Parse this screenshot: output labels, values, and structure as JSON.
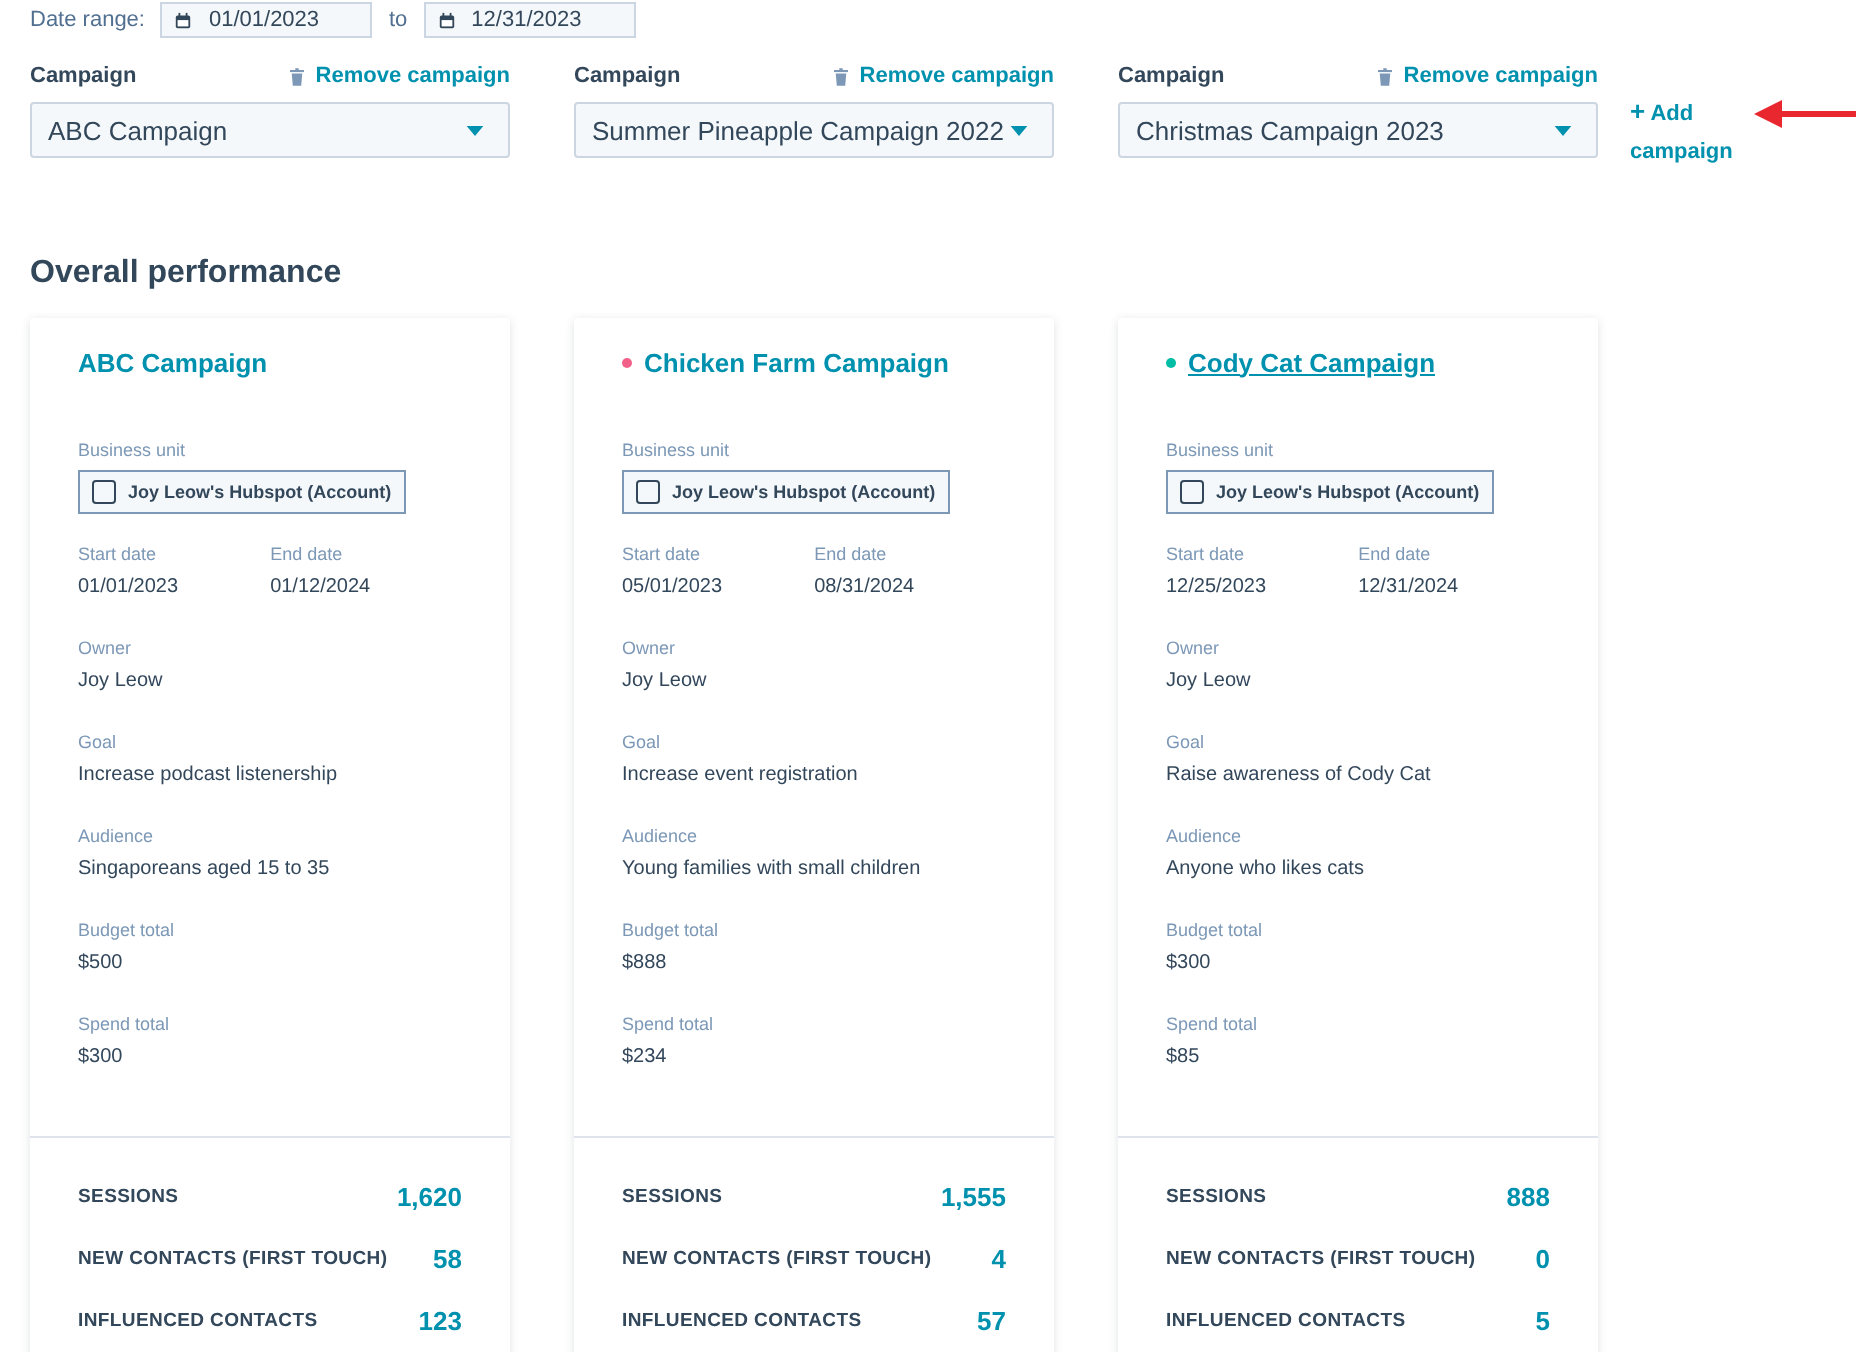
{
  "date_range": {
    "label": "Date range:",
    "start": "01/01/2023",
    "separator": "to",
    "end": "12/31/2023"
  },
  "selectors": [
    {
      "label": "Campaign",
      "remove": "Remove campaign",
      "value": "ABC Campaign"
    },
    {
      "label": "Campaign",
      "remove": "Remove campaign",
      "value": "Summer Pineapple Campaign 2022"
    },
    {
      "label": "Campaign",
      "remove": "Remove campaign",
      "value": "Christmas Campaign 2023"
    }
  ],
  "add_campaign": {
    "icon": "+",
    "label": "Add campaign"
  },
  "section_title": "Overall performance",
  "cards": [
    {
      "title": "ABC Campaign",
      "underlined": false,
      "business_unit_label": "Business unit",
      "business_unit": "Joy Leow's Hubspot (Account)",
      "fields": [
        {
          "label": "Start date",
          "value": "01/01/2023"
        },
        {
          "label": "End date",
          "value": "01/12/2024"
        },
        {
          "label": "Owner",
          "value": "Joy Leow"
        },
        {
          "label": "Goal",
          "value": "Increase podcast listenership"
        },
        {
          "label": "Audience",
          "value": "Singaporeans aged 15 to 35"
        },
        {
          "label": "Budget total",
          "value": "$500"
        },
        {
          "label": "Spend total",
          "value": "$300"
        }
      ],
      "metrics": [
        {
          "label": "SESSIONS",
          "value": "1,620"
        },
        {
          "label": "NEW CONTACTS (FIRST TOUCH)",
          "value": "58"
        },
        {
          "label": "INFLUENCED CONTACTS",
          "value": "123"
        }
      ]
    },
    {
      "title": "Chicken Farm Campaign",
      "color": "#f2618a",
      "underlined": false,
      "business_unit_label": "Business unit",
      "business_unit": "Joy Leow's Hubspot (Account)",
      "fields": [
        {
          "label": "Start date",
          "value": "05/01/2023"
        },
        {
          "label": "End date",
          "value": "08/31/2024"
        },
        {
          "label": "Owner",
          "value": "Joy Leow"
        },
        {
          "label": "Goal",
          "value": "Increase event registration"
        },
        {
          "label": "Audience",
          "value": "Young families with small children"
        },
        {
          "label": "Budget total",
          "value": "$888"
        },
        {
          "label": "Spend total",
          "value": "$234"
        }
      ],
      "metrics": [
        {
          "label": "SESSIONS",
          "value": "1,555"
        },
        {
          "label": "NEW CONTACTS (FIRST TOUCH)",
          "value": "4"
        },
        {
          "label": "INFLUENCED CONTACTS",
          "value": "57"
        }
      ]
    },
    {
      "title": "Cody Cat Campaign",
      "color": "#00bda5",
      "underlined": true,
      "business_unit_label": "Business unit",
      "business_unit": "Joy Leow's Hubspot (Account)",
      "fields": [
        {
          "label": "Start date",
          "value": "12/25/2023"
        },
        {
          "label": "End date",
          "value": "12/31/2024"
        },
        {
          "label": "Owner",
          "value": "Joy Leow"
        },
        {
          "label": "Goal",
          "value": "Raise awareness of Cody Cat"
        },
        {
          "label": "Audience",
          "value": "Anyone who likes cats"
        },
        {
          "label": "Budget total",
          "value": "$300"
        },
        {
          "label": "Spend total",
          "value": "$85"
        }
      ],
      "metrics": [
        {
          "label": "SESSIONS",
          "value": "888"
        },
        {
          "label": "NEW CONTACTS (FIRST TOUCH)",
          "value": "0"
        },
        {
          "label": "INFLUENCED CONTACTS",
          "value": "5"
        }
      ]
    }
  ]
}
